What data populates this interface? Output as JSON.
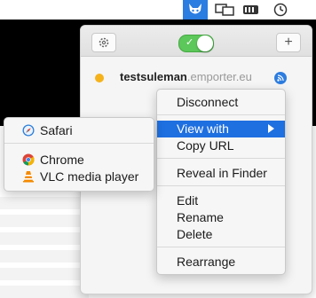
{
  "connection": {
    "user": "testsuleman",
    "host": ".emporter.eu"
  },
  "menu": {
    "disconnect": "Disconnect",
    "view_with": "View with",
    "copy_url": "Copy URL",
    "reveal_in_finder": "Reveal in Finder",
    "edit": "Edit",
    "rename": "Rename",
    "delete": "Delete",
    "rearrange": "Rearrange"
  },
  "submenu": {
    "safari": "Safari",
    "chrome": "Chrome",
    "vlc": "VLC media player"
  },
  "toolbar": {
    "add_label": "+"
  },
  "colors": {
    "accent": "#1e6fe0",
    "toggle_on": "#5cc75a",
    "status_dot": "#f5b21b"
  }
}
